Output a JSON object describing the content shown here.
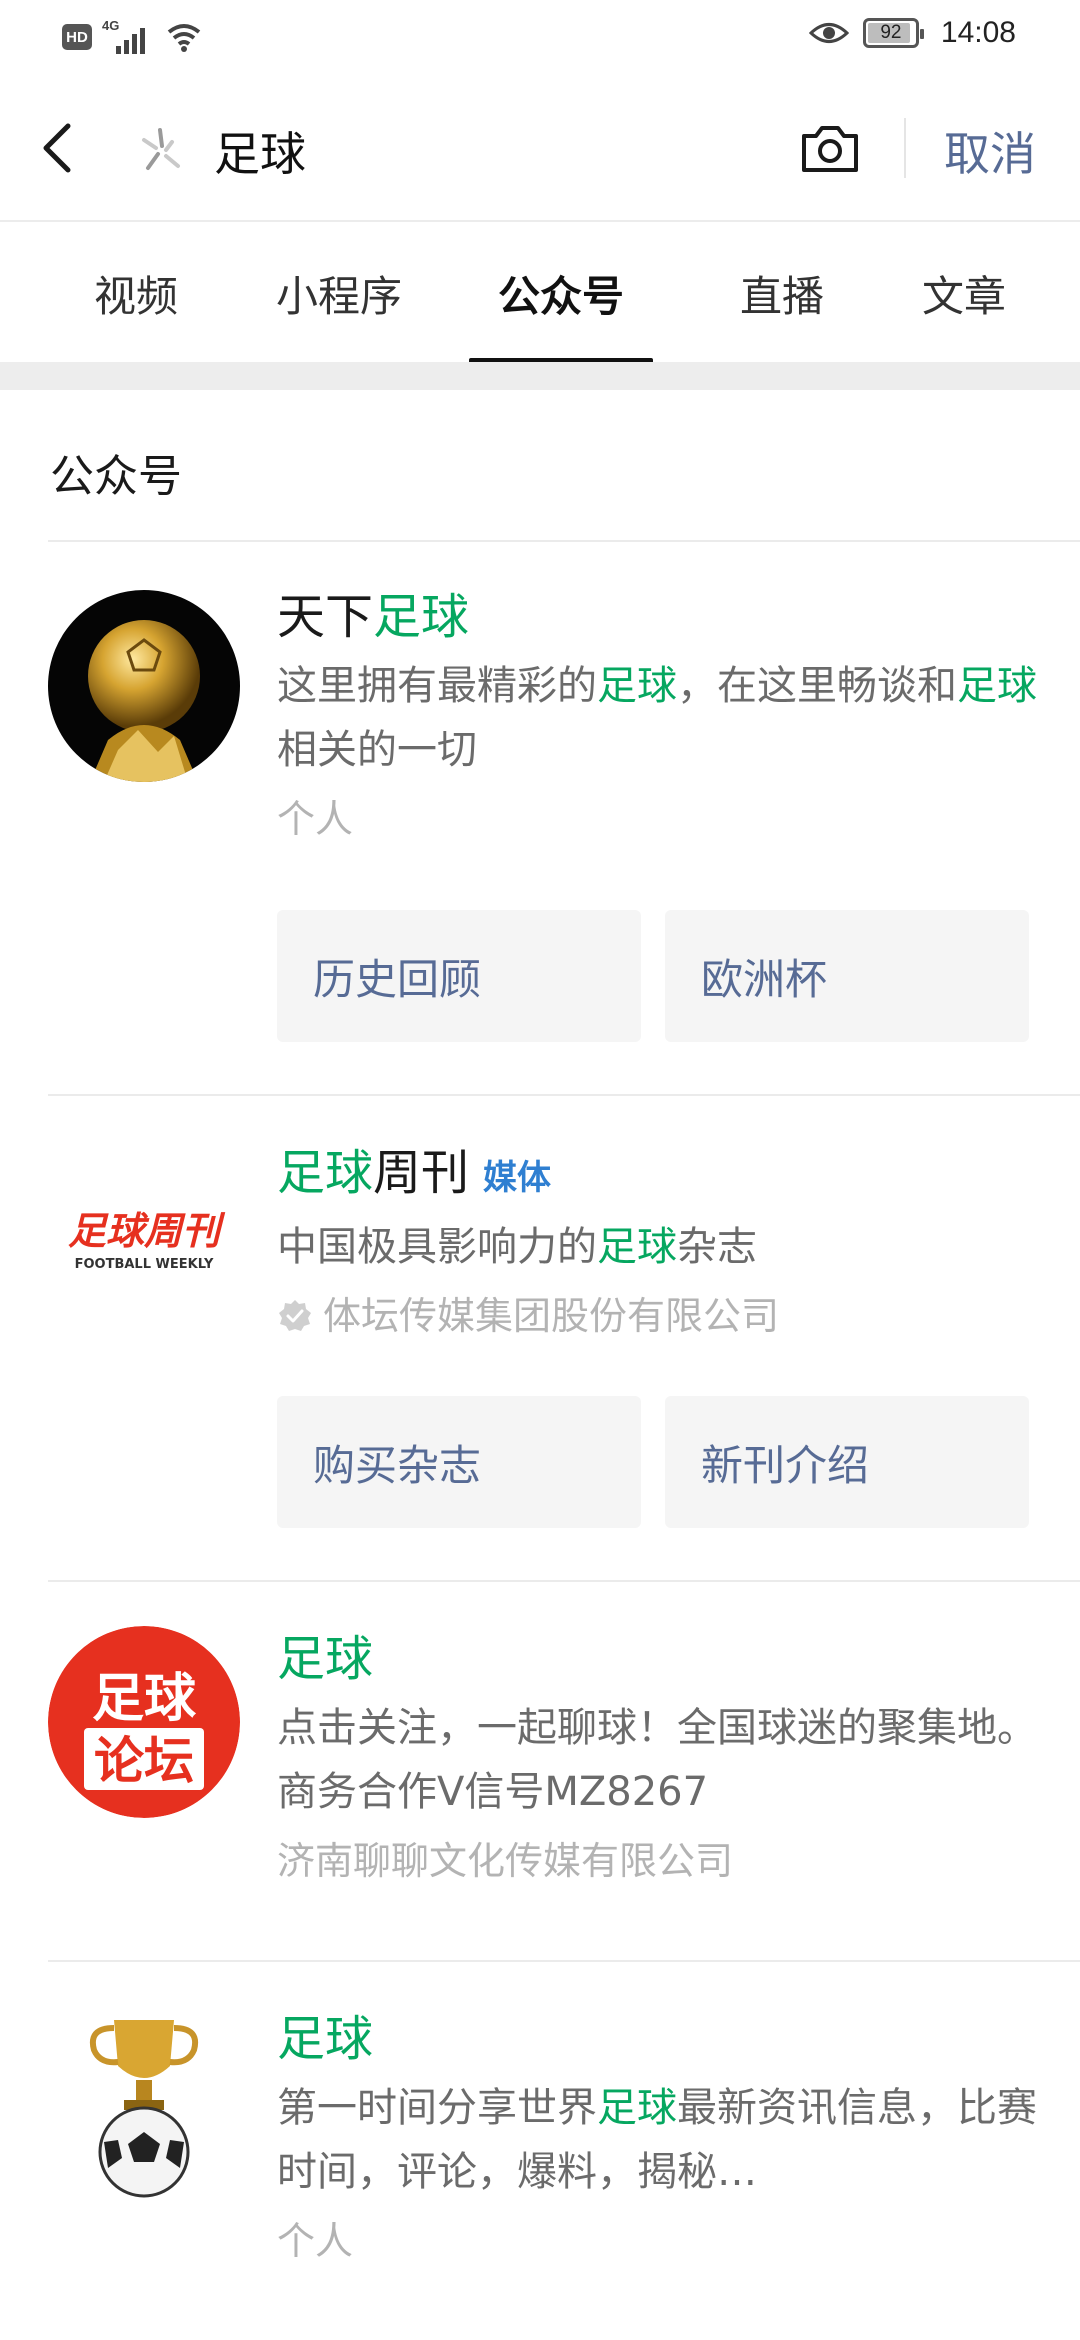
{
  "status_bar": {
    "hd": "HD",
    "network": "4G",
    "battery_level": 92,
    "battery_text": "92",
    "time": "14:08"
  },
  "search": {
    "query": "足球",
    "cancel_label": "取消"
  },
  "tabs": [
    {
      "label": "视频",
      "active": false
    },
    {
      "label": "小程序",
      "active": false
    },
    {
      "label": "公众号",
      "active": true
    },
    {
      "label": "直播",
      "active": false
    },
    {
      "label": "文章",
      "active": false
    }
  ],
  "section": {
    "title": "公众号"
  },
  "results": [
    {
      "name_prefix": "天下",
      "name_highlight": "足球",
      "name_suffix": "",
      "desc_parts": [
        "这里拥有最精彩的",
        "足球",
        "，在这里畅谈和",
        "足球",
        "相关的一切"
      ],
      "sub_label": "个人",
      "buttons": [
        "历史回顾",
        "欧洲杯"
      ]
    },
    {
      "name_prefix": "",
      "name_highlight": "足球",
      "name_suffix": "周刊",
      "badge": "媒体",
      "logo_text": "足球周刊",
      "logo_sub": "FOOTBALL WEEKLY",
      "desc_parts": [
        "中国极具影响力的",
        "足球",
        "杂志"
      ],
      "sub_label": "体坛传媒集团股份有限公司",
      "buttons": [
        "购买杂志",
        "新刊介绍"
      ]
    },
    {
      "name_highlight": "足球",
      "logo_line1": "足球",
      "logo_line2": "论坛",
      "desc": "点击关注，一起聊球！全国球迷的聚集地。商务合作V信号MZ8267",
      "sub_label": "济南聊聊文化传媒有限公司"
    },
    {
      "name_highlight": "足球",
      "desc_parts": [
        "第一时间分享世界",
        "足球",
        "最新资讯信息，比赛时间，评论，爆料，揭秘…"
      ],
      "sub_label": "个人"
    }
  ],
  "colors": {
    "highlight": "#06a760",
    "link": "#576b95",
    "badge": "#2f7fd1",
    "logo_red": "#e6301f"
  }
}
